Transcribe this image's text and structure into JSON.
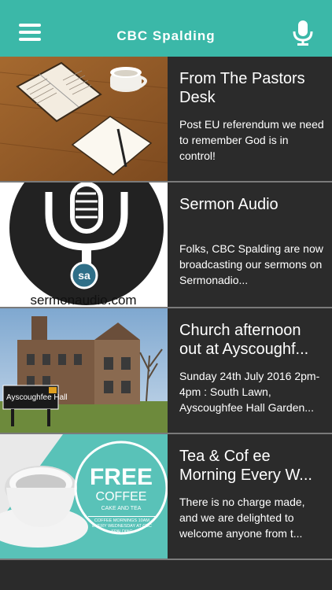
{
  "header": {
    "title": "CBC Spalding",
    "menu_icon": "hamburger-menu-icon",
    "mic_icon": "microphone-icon"
  },
  "colors": {
    "header_bg": "#3bb8a8",
    "list_bg": "#2b2b2b",
    "separator": "#7a7a7a",
    "text": "#ffffff"
  },
  "items": [
    {
      "headline": "From The Pastors Desk",
      "excerpt": "Post EU referendum we need to remember God is in control!"
    },
    {
      "headline": "Sermon Audio",
      "excerpt": "Folks, CBC Spalding are now broadcasting our sermons on Sermonadio...",
      "thumb_logo": "sermonaudio.com",
      "thumb_badge": "sa"
    },
    {
      "headline": "Church afternoon out at Ayscoughf...",
      "excerpt": "Sunday 24th July 2016 2pm-4pm : South Lawn, Ayscoughfee Hall Garden...",
      "thumb_sign": "Ayscoughfee Hall"
    },
    {
      "headline": "Tea & Cof ee Morning Every W...",
      "excerpt": "There is no charge made, and we are delighted to welcome anyone from t...",
      "thumb_big": "FREE",
      "thumb_sub": "COFFEE",
      "thumb_small": "CAKE AND TEA",
      "thumb_footer": "COFFEE MORNINGS 10AM EVERY WEDNESDAY AT CBC SPALDING"
    }
  ]
}
